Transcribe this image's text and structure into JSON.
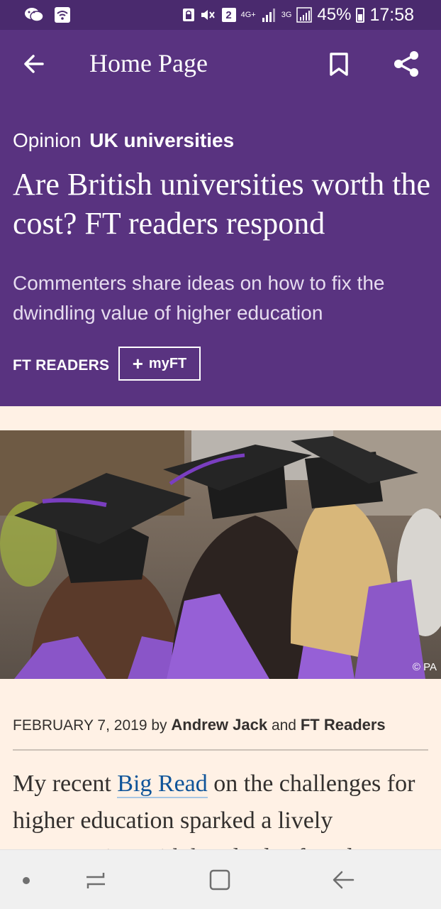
{
  "status_bar": {
    "sim_label": "2",
    "network_4g": "4G+",
    "network_3g": "3G",
    "battery": "45%",
    "time": "17:58"
  },
  "app_bar": {
    "title": "Home Page"
  },
  "article": {
    "kicker_label": "Opinion",
    "kicker_topic": "UK universities",
    "headline": "Are British universities worth the cost? FT readers respond",
    "standfirst": "Commenters share ideas on how to fix the dwindling value of higher education",
    "author_tag": "FT READERS",
    "myft_label": "myFT",
    "image_credit": "© PA",
    "byline": {
      "date": "FEBRUARY 7, 2019",
      "by": "by",
      "author1": "Andrew Jack",
      "and": "and",
      "author2": "FT Readers"
    },
    "body": {
      "before_link": "My recent ",
      "link": "Big Read",
      "after_link": " on the challenges for higher education sparked a lively conversation with hundreds of readers"
    }
  },
  "colors": {
    "header_purple": "#593380",
    "status_purple": "#4a2a6e",
    "page_background": "#fff1e5",
    "link_blue": "#0f5499"
  }
}
